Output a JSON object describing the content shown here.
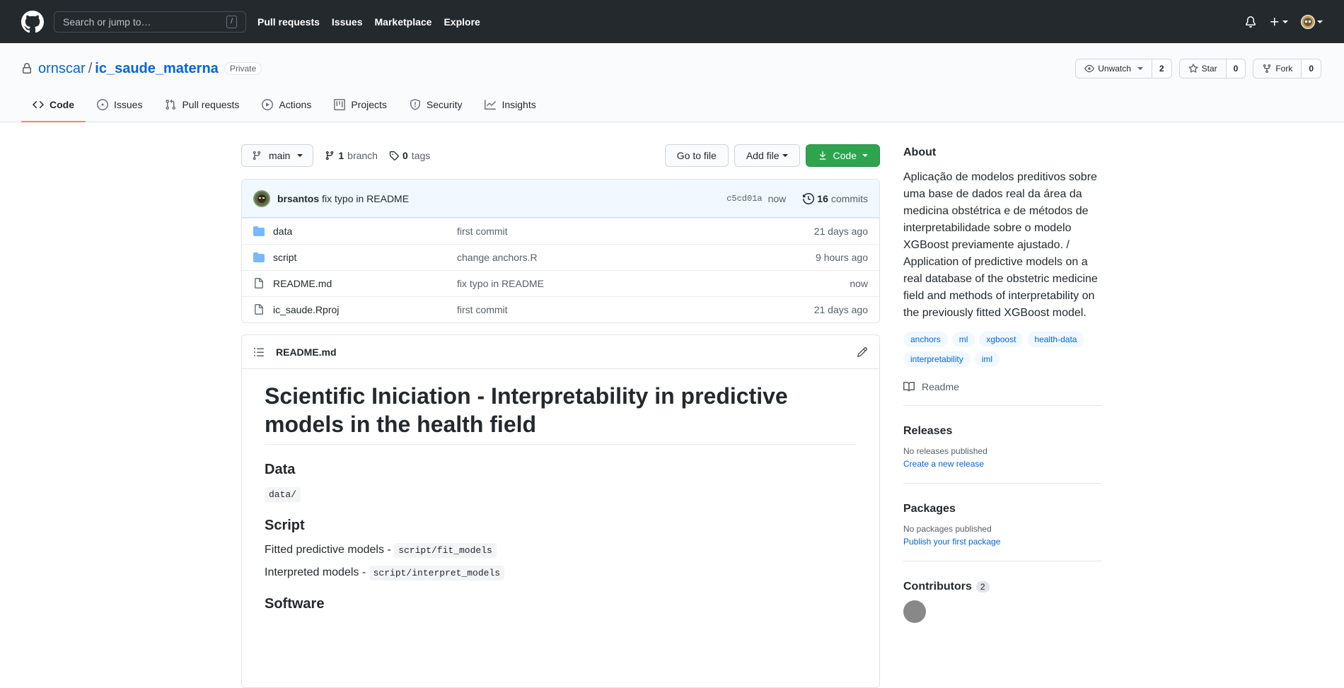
{
  "header": {
    "search_placeholder": "Search or jump to…",
    "search_hint": "/",
    "nav": [
      "Pull requests",
      "Issues",
      "Marketplace",
      "Explore"
    ]
  },
  "repo": {
    "owner": "ornscar",
    "separator": "/",
    "name": "ic_saude_materna",
    "visibility": "Private",
    "watch_label": "Unwatch",
    "watch_count": "2",
    "star_label": "Star",
    "star_count": "0",
    "fork_label": "Fork",
    "fork_count": "0"
  },
  "tabs": [
    {
      "label": "Code",
      "icon": "code-icon"
    },
    {
      "label": "Issues",
      "icon": "issue-icon"
    },
    {
      "label": "Pull requests",
      "icon": "pull-request-icon"
    },
    {
      "label": "Actions",
      "icon": "play-icon"
    },
    {
      "label": "Projects",
      "icon": "project-icon"
    },
    {
      "label": "Security",
      "icon": "shield-icon"
    },
    {
      "label": "Insights",
      "icon": "graph-icon"
    }
  ],
  "toolbar": {
    "branch": "main",
    "branch_count": "1",
    "branch_label": "branch",
    "tag_count": "0",
    "tag_label": "tags",
    "go_to_file": "Go to file",
    "add_file": "Add file",
    "code": "Code"
  },
  "commit": {
    "author": "brsantos",
    "message": "fix typo in README",
    "sha": "c5cd01a",
    "time": "now",
    "count": "16",
    "count_label": "commits"
  },
  "files": [
    {
      "name": "data",
      "type": "folder",
      "message": "first commit",
      "age": "21 days ago"
    },
    {
      "name": "script",
      "type": "folder",
      "message": "change anchors.R",
      "age": "9 hours ago"
    },
    {
      "name": "README.md",
      "type": "file",
      "message": "fix typo in README",
      "age": "now"
    },
    {
      "name": "ic_saude.Rproj",
      "type": "file",
      "message": "first commit",
      "age": "21 days ago"
    }
  ],
  "readme": {
    "filename": "README.md",
    "title": "Scientific Iniciation - Interpretability in predictive models in the health field",
    "data_heading": "Data",
    "data_code": "data/",
    "script_heading": "Script",
    "fitted_text": "Fitted predictive models - ",
    "fitted_code": "script/fit_models",
    "interpreted_text": "Interpreted models - ",
    "interpreted_code": "script/interpret_models",
    "software_heading": "Software"
  },
  "about": {
    "heading": "About",
    "description": "Aplicação de modelos preditivos sobre uma base de dados real da área da medicina obstétrica e de métodos de interpretabilidade sobre o modelo XGBoost previamente ajustado. / Application of predictive models on a real database of the obstetric medicine field and methods of interpretability on the previously fitted XGBoost model.",
    "topics": [
      "anchors",
      "ml",
      "xgboost",
      "health-data",
      "interpretability",
      "iml"
    ],
    "readme_link": "Readme"
  },
  "releases": {
    "heading": "Releases",
    "empty": "No releases published",
    "action": "Create a new release"
  },
  "packages": {
    "heading": "Packages",
    "empty": "No packages published",
    "action": "Publish your first package"
  },
  "contributors": {
    "heading": "Contributors",
    "count": "2"
  }
}
